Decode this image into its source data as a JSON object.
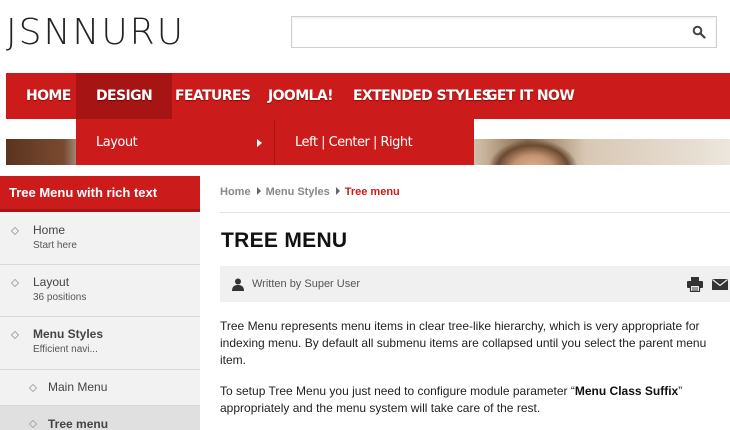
{
  "header": {
    "logo": "JSNNURU",
    "search": {
      "value": "",
      "placeholder": ""
    }
  },
  "nav": {
    "items": [
      {
        "label": "HOME",
        "active": false
      },
      {
        "label": "DESIGN",
        "active": true
      },
      {
        "label": "FEATURES",
        "active": false
      },
      {
        "label": "JOOMLA!",
        "active": false
      },
      {
        "label": "EXTENDED STYLES",
        "active": false
      },
      {
        "label": "GET IT NOW",
        "active": false
      }
    ],
    "dropdown": {
      "label": "Layout",
      "submenu_label": "Left | Center | Right"
    }
  },
  "sidebar": {
    "title": "Tree Menu with rich text",
    "items": [
      {
        "label": "Home",
        "sub": "Start here"
      },
      {
        "label": "Layout",
        "sub": "36 positions"
      },
      {
        "label": "Menu Styles",
        "sub": "Efficient navi..."
      },
      {
        "label": "Main Menu"
      },
      {
        "label": "Tree menu"
      }
    ]
  },
  "breadcrumb": [
    "Home",
    "Menu Styles",
    "Tree menu"
  ],
  "article": {
    "title": "TREE MENU",
    "author": "Written by Super User",
    "p1": "Tree Menu represents menu items in clear tree-like hierarchy, which is very appropriate for indexing menu. By default all submenu items are collapsed until you select the parent menu item.",
    "p2_a": "To setup Tree Menu you just need to configure module parameter “",
    "p2_b": "Menu Class Suffix",
    "p2_c": "” appropriately and the menu system will take care of the rest."
  },
  "colors": {
    "brand_red": "#cc1b1b",
    "active_red": "#a71414"
  }
}
